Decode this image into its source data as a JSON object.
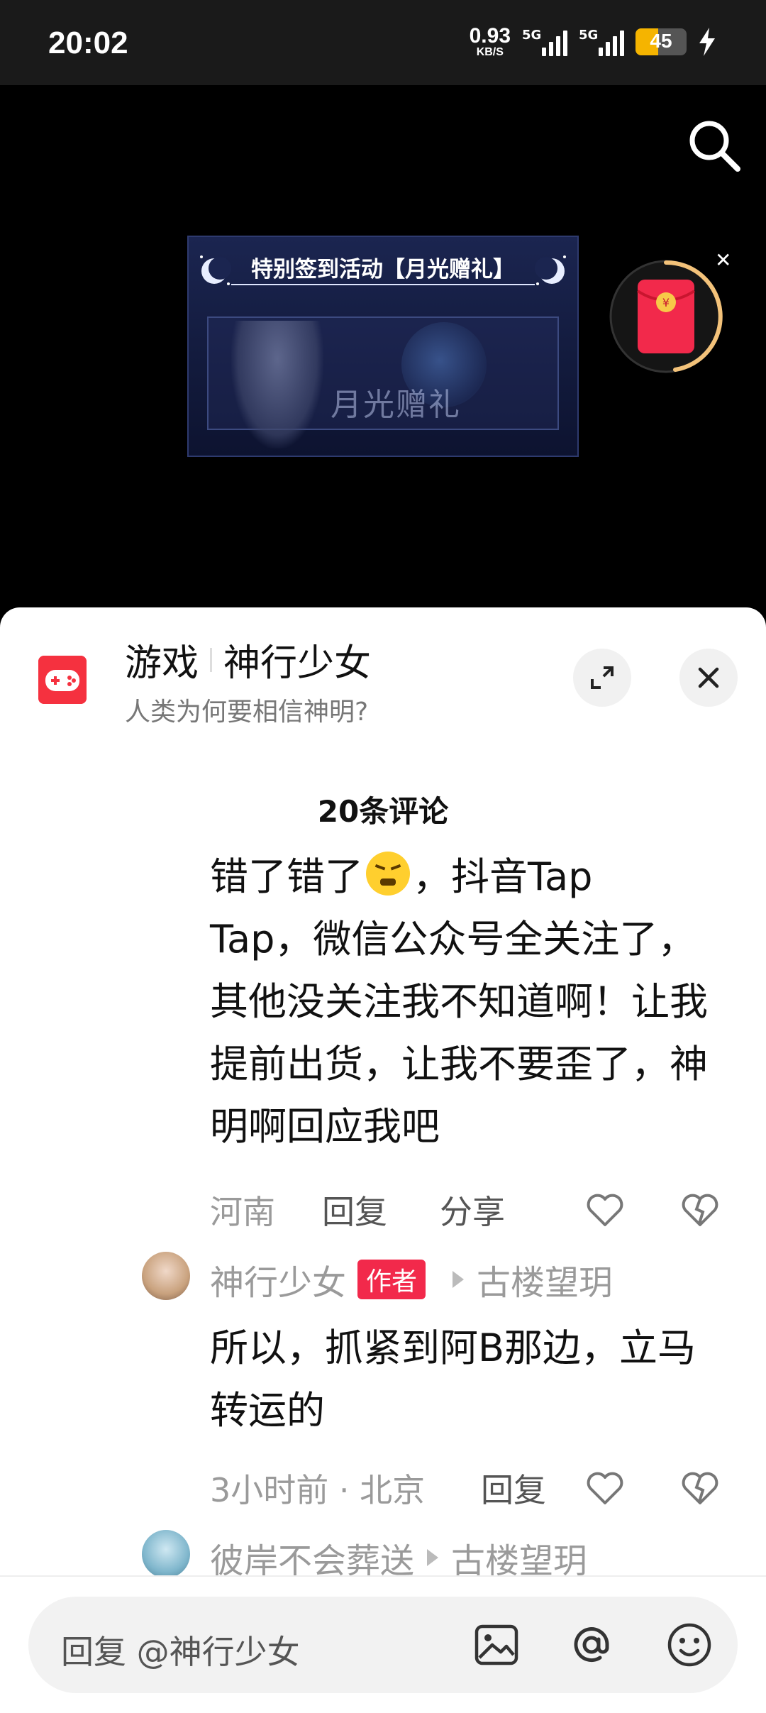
{
  "status_bar": {
    "time": "20:02",
    "net_speed_value": "0.93",
    "net_speed_unit": "KB/S",
    "sim1_tag": "5G",
    "sim2_tag": "5G",
    "battery_level": "45"
  },
  "video": {
    "banner_title": "特别签到活动【月光赠礼】",
    "banner_logo_text": "月光赠礼"
  },
  "sheet": {
    "topic_category": "游戏",
    "topic_name": "神行少女",
    "topic_subtitle": "人类为何要相信神明?",
    "comment_count": "20条评论"
  },
  "comment": {
    "text_line1_a": "错了错了",
    "text_line1_b": "，抖音Tap",
    "text_rest": "Tap，微信公众号全关注了，其他没关注我不知道啊！让我提前出货，让我不要歪了，神明啊回应我吧",
    "location": "河南",
    "reply_label": "回复",
    "share_label": "分享"
  },
  "reply1": {
    "author": "神行少女",
    "badge": "作者",
    "reply_to": "古楼望玥",
    "text": "所以，抓紧到阿B那边，立马转运的",
    "time_location": "3小时前 · 北京",
    "reply_label": "回复"
  },
  "reply2": {
    "author": "彼岸不会葬送",
    "reply_to": "古楼望玥"
  },
  "input": {
    "placeholder": "回复 @神行少女"
  },
  "colors": {
    "accent_red": "#f2294b",
    "battery_yellow": "#f5b400"
  }
}
